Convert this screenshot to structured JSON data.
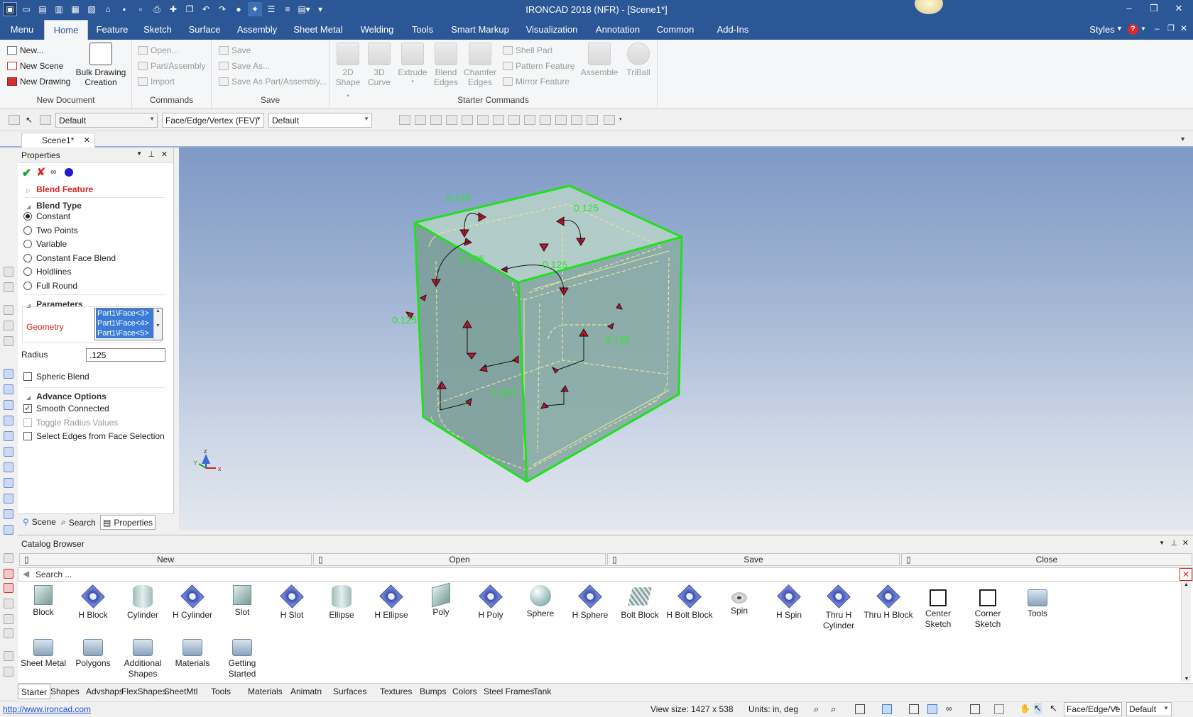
{
  "app": {
    "title": "IRONCAD 2018 (NFR) - [Scene1*]"
  },
  "window_controls": {
    "minimize": "–",
    "restore": "❐",
    "close": "✕"
  },
  "ribbon_tabs": [
    "Menu",
    "Home",
    "Feature",
    "Sketch",
    "Surface",
    "Assembly",
    "Sheet Metal",
    "Welding",
    "Tools",
    "Smart Markup",
    "Visualization",
    "Annotation",
    "Common",
    "Add-Ins"
  ],
  "ribbon_right": {
    "styles": "Styles",
    "help": "?"
  },
  "groups": {
    "new_document": {
      "label": "New Document",
      "new": "New...",
      "new_scene": "New Scene",
      "new_drawing": "New Drawing",
      "bulk_line1": "Bulk Drawing",
      "bulk_line2": "Creation"
    },
    "commands": {
      "label": "Commands",
      "open": "Open...",
      "part_assembly": "Part/Assembly",
      "import": "Import"
    },
    "save": {
      "label": "Save",
      "save": "Save",
      "save_as": "Save As...",
      "save_as_part": "Save As Part/Assembly..."
    },
    "starter": {
      "label": "Starter Commands",
      "shape2d_1": "2D",
      "shape2d_2": "Shape",
      "curve3d_1": "3D",
      "curve3d_2": "Curve",
      "extrude": "Extrude",
      "blend_1": "Blend",
      "blend_2": "Edges",
      "chamfer_1": "Chamfer",
      "chamfer_2": "Edges",
      "shell_part": "Shell Part",
      "pattern_feature": "Pattern Feature",
      "mirror_feature": "Mirror Feature",
      "assemble": "Assemble",
      "triball": "TriBall"
    }
  },
  "toolbar": {
    "style_combo": "Default",
    "selection_combo": "Face/Edge/Vertex (FEV)",
    "render_combo": "Default"
  },
  "doc_tab": {
    "label": "Scene1*",
    "close": "✕"
  },
  "properties": {
    "title": "Properties",
    "feature_name": "Blend Feature",
    "blend_type_header": "Blend Type",
    "blend_types": [
      {
        "label": "Constant",
        "selected": true
      },
      {
        "label": "Two Points",
        "selected": false
      },
      {
        "label": "Variable",
        "selected": false
      },
      {
        "label": "Constant Face Blend",
        "selected": false
      },
      {
        "label": "Holdlines",
        "selected": false
      },
      {
        "label": "Full Round",
        "selected": false
      }
    ],
    "parameters_header": "Parameters",
    "geometry_label": "Geometry",
    "geometry_items": [
      "Part1\\Face<3>",
      "Part1\\Face<4>",
      "Part1\\Face<5>"
    ],
    "radius_label": "Radius",
    "radius_value": ".125",
    "spheric_blend": "Spheric Blend",
    "advance_header": "Advance Options",
    "smooth_connected": "Smooth Connected",
    "toggle_radius": "Toggle Radius Values",
    "select_edges": "Select Edges from Face Selection",
    "bottom_tabs": [
      "Scene",
      "Search",
      "Properties"
    ]
  },
  "viewport": {
    "dimension_label": "0.125",
    "axis_labels": {
      "x": "x",
      "y": "Y",
      "z": "z"
    },
    "colors": {
      "edge_highlight": "#22e01e",
      "arrow": "#c8102e",
      "dim_text": "#2be52b",
      "cube_face": "#8fb3b0"
    }
  },
  "catalog": {
    "title": "Catalog Browser",
    "buttons": [
      "New",
      "Open",
      "Save",
      "Close"
    ],
    "search_placeholder": "Search ...",
    "items": [
      {
        "label": "Block",
        "icon": "block-shape-icon"
      },
      {
        "label": "H Block",
        "icon": "hollow-block-icon"
      },
      {
        "label": "Cylinder",
        "icon": "cylinder-shape-icon"
      },
      {
        "label": "H Cylinder",
        "icon": "hollow-cylinder-icon"
      },
      {
        "label": "Slot",
        "icon": "slot-shape-icon"
      },
      {
        "label": "H Slot",
        "icon": "hollow-slot-icon"
      },
      {
        "label": "Ellipse",
        "icon": "ellipse-shape-icon"
      },
      {
        "label": "H Ellipse",
        "icon": "hollow-ellipse-icon"
      },
      {
        "label": "Poly",
        "icon": "poly-shape-icon"
      },
      {
        "label": "H Poly",
        "icon": "hollow-poly-icon"
      },
      {
        "label": "Sphere",
        "icon": "sphere-shape-icon"
      },
      {
        "label": "H Sphere",
        "icon": "hollow-sphere-icon"
      },
      {
        "label": "Bolt Block",
        "icon": "bolt-block-icon"
      },
      {
        "label": "H Bolt Block",
        "icon": "hollow-bolt-block-icon"
      },
      {
        "label": "Spin",
        "icon": "spin-shape-icon"
      },
      {
        "label": "H Spin",
        "icon": "hollow-spin-icon"
      },
      {
        "label": "Thru H Cylinder",
        "icon": "thru-hole-cylinder-icon"
      },
      {
        "label": "Thru H Block",
        "icon": "thru-hole-block-icon"
      },
      {
        "label": "Center Sketch",
        "icon": "center-sketch-icon"
      },
      {
        "label": "Corner Sketch",
        "icon": "corner-sketch-icon"
      },
      {
        "label": "Tools",
        "icon": "folder-icon"
      },
      {
        "label": "Sheet Metal",
        "icon": "folder-icon"
      },
      {
        "label": "Polygons",
        "icon": "folder-icon"
      },
      {
        "label": "Additional Shapes",
        "icon": "folder-icon"
      },
      {
        "label": "Materials",
        "icon": "folder-icon"
      },
      {
        "label": "Getting Started",
        "icon": "folder-icon"
      }
    ],
    "tabs": [
      "Starter",
      "Shapes",
      "Advshaps",
      "FlexShapes",
      "SheetMtl",
      "Tools",
      "Materials",
      "Animatn",
      "Surfaces",
      "Textures",
      "Bumps",
      "Colors",
      "Steel Frames",
      "Tank"
    ]
  },
  "status": {
    "url": "http://www.ironcad.com",
    "view_size": "View size: 1427 x  538",
    "units": "Units: in, deg",
    "selection_combo": "Face/Edge/Ve",
    "render_combo": "Default"
  }
}
